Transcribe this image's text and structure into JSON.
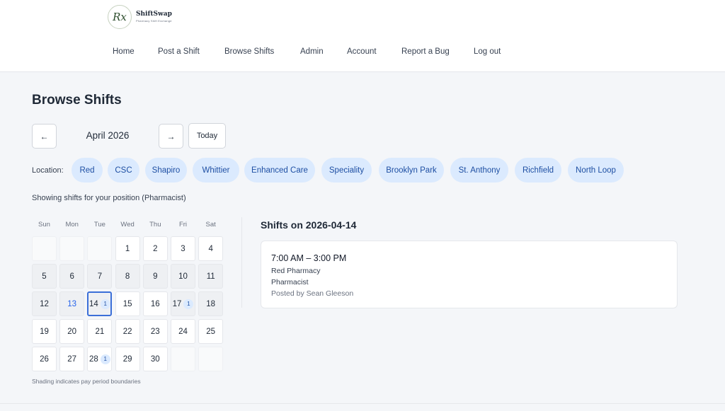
{
  "brand": {
    "logo_mark": "Rx",
    "name": "ShiftSwap",
    "tagline": "Pharmacy Shift Exchange"
  },
  "nav": [
    "Home",
    "Post a Shift",
    "Browse Shifts",
    "Admin",
    "Account",
    "Report a Bug",
    "Log out"
  ],
  "page": {
    "title": "Browse Shifts"
  },
  "month_nav": {
    "prev": "←",
    "label": "April 2026",
    "next": "→",
    "today": "Today"
  },
  "location": {
    "label": "Location:",
    "options": [
      "Red",
      "CSC",
      "Shapiro",
      "Whittier",
      "Enhanced Care",
      "Speciality",
      "Brooklyn Park",
      "St. Anthony",
      "Richfield",
      "North Loop"
    ]
  },
  "showing_text": "Showing shifts for your position (Pharmacist)",
  "calendar": {
    "weekdays": [
      "Sun",
      "Mon",
      "Tue",
      "Wed",
      "Thu",
      "Fri",
      "Sat"
    ],
    "first_weekday_index": 3,
    "days_in_month": 30,
    "today": 13,
    "selected": 14,
    "shaded_days": [
      5,
      6,
      7,
      8,
      9,
      10,
      11,
      12,
      13,
      14,
      17,
      18
    ],
    "shift_counts": {
      "14": "1",
      "17": "1",
      "28": "1"
    },
    "note": "Shading indicates pay period boundaries"
  },
  "shifts_panel": {
    "title": "Shifts on 2026-04-14",
    "shifts": [
      {
        "time": "7:00 AM – 3:00 PM",
        "location": "Red Pharmacy",
        "position": "Pharmacist",
        "posted_by": "Posted by Sean Gleeson"
      }
    ]
  }
}
